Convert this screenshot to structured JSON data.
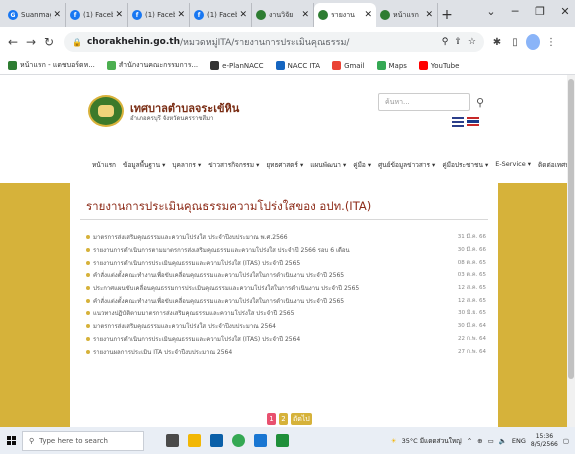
{
  "browser": {
    "tabs": [
      {
        "title": "Suanmag",
        "fav_color": "#1877f2",
        "fav_glyph": "G",
        "active": false
      },
      {
        "title": "(1) Faceb",
        "fav_color": "#1877f2",
        "fav_glyph": "f",
        "active": false
      },
      {
        "title": "(1) Faceb",
        "fav_color": "#1877f2",
        "fav_glyph": "f",
        "active": false
      },
      {
        "title": "(1) Faceb",
        "fav_color": "#1877f2",
        "fav_glyph": "f",
        "active": false
      },
      {
        "title": "งานวิจัย",
        "fav_color": "#2e7d32",
        "fav_glyph": "",
        "active": false
      },
      {
        "title": "รายงาน",
        "fav_color": "#2e7d32",
        "fav_glyph": "",
        "active": true
      },
      {
        "title": "หน้าแรก",
        "fav_color": "#2e7d32",
        "fav_glyph": "",
        "active": false
      }
    ],
    "new_tab": "+",
    "url_host": "chorakhehin.go.th",
    "url_path": "/หมวดหมู่ITA/รายงานการประเมินคุณธรรม/",
    "bookmarks": [
      {
        "label": "หน้าแรก - แดชบอร์ดห...",
        "color": "#2e7d32"
      },
      {
        "label": "สำนักงานคณะกรรมการ...",
        "color": "#4caf50"
      },
      {
        "label": "e-PlanNACC",
        "color": "#333333"
      },
      {
        "label": "NACC ITA",
        "color": "#1565c0"
      },
      {
        "label": "Gmail",
        "color": "#ea4335"
      },
      {
        "label": "Maps",
        "color": "#34a853"
      },
      {
        "label": "YouTube",
        "color": "#ff0000"
      }
    ]
  },
  "site": {
    "name": "เทศบาลตำบลจระเข้หิน",
    "subtitle": "อำเภอครบุรี จังหวัดนครราชสีมา",
    "search_placeholder": "ค้นหา...",
    "nav": [
      "หน้าแรก",
      "ข้อมูลพื้นฐาน ▾",
      "บุคลากร ▾",
      "ข่าวสารกิจกรรม ▾",
      "ยุทธศาสตร์ ▾",
      "แผนพัฒนา ▾",
      "คู่มือ ▾",
      "ศูนย์ข้อมูลข่าวสาร ▾",
      "คู่มือประชาชน ▾",
      "E-Service ▾",
      "ติดต่อเทศบาล"
    ]
  },
  "main": {
    "heading": "รายงานการประเมินคุณธรรมความโปร่งใสของ อปท.(ITA)",
    "items": [
      {
        "text": "มาตรการส่งเสริมคุณธรรมและความโปร่งใส ประจำปีงบประมาณ พ.ศ.2566",
        "date": "31 มี.ค. 66"
      },
      {
        "text": "รายงานการดำเนินการตามมาตรการส่งเสริมคุณธรรมและความโปร่งใส ประจำปี 2566 รอบ 6 เดือน",
        "date": "30 มี.ค. 66"
      },
      {
        "text": "รายงานการดำเนินการประเมินคุณธรรมและความโปร่งใส (ITAS) ประจำปี 2565",
        "date": "08 ต.ค. 65"
      },
      {
        "text": "คำสั่งแต่งตั้งคณะทำงานเพื่อขับเคลื่อนคุณธรรมและความโปร่งใสในการดำเนินงาน ประจำปี 2565",
        "date": "03 ต.ค. 65"
      },
      {
        "text": "ประกาศแผนขับเคลื่อนคุณธรรมการประเมินคุณธรรมและความโปร่งใสในการดำเนินงาน ประจำปี 2565",
        "date": "12 ส.ค. 65"
      },
      {
        "text": "คำสั่งแต่งตั้งคณะทำงานเพื่อขับเคลื่อนคุณธรรมและความโปร่งใสในการดำเนินงาน ประจำปี 2565",
        "date": "12 ส.ค. 65"
      },
      {
        "text": "แนวทางปฏิบัติตามมาตรการส่งเสริมคุณธรรมและความโปร่งใส ประจำปี 2565",
        "date": "30 มิ.ย. 65"
      },
      {
        "text": "มาตรการส่งเสริมคุณธรรมและความโปร่งใส ประจำปีงบประมาณ 2564",
        "date": "30 มี.ค. 64"
      },
      {
        "text": "รายงานการดำเนินการประเมินคุณธรรมและความโปร่งใส (ITAS) ประจำปี 2564",
        "date": "22 ก.พ. 64"
      },
      {
        "text": "รายงานผลการประเมิน ITA ประจำปีงบประมาณ 2564",
        "date": "27 ก.พ. 64"
      }
    ],
    "pager": [
      {
        "label": "1",
        "active": true
      },
      {
        "label": "2",
        "active": false
      },
      {
        "label": "ถัดไป",
        "active": false
      }
    ]
  },
  "taskbar": {
    "search_placeholder": "Type here to search",
    "weather": "35°C มีแดดส่วนใหญ่",
    "lang": "ENG",
    "time": "15:36",
    "date": "8/5/2566"
  },
  "colors": {
    "gold": "#d6b23a",
    "heading": "#8c2a17",
    "pager_active": "#e8516f"
  }
}
